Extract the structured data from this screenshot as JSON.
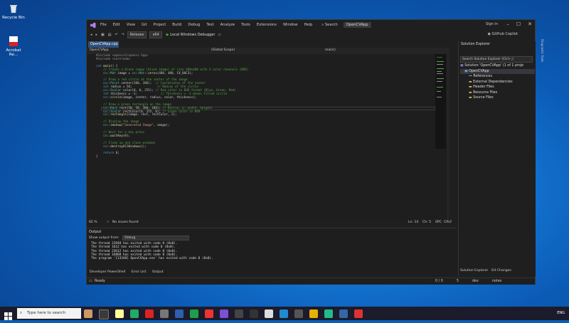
{
  "desktop": {
    "icons": [
      {
        "label": "Recycle Bin"
      },
      {
        "label": "Acrobat Re..."
      }
    ]
  },
  "titlebar": {
    "menu": [
      "File",
      "Edit",
      "View",
      "Git",
      "Project",
      "Build",
      "Debug",
      "Test",
      "Analyze",
      "Tools",
      "Extensions",
      "Window",
      "Help"
    ],
    "search": "Search",
    "app_title": "OpenCVApp",
    "sign_in": "Sign in"
  },
  "toolbar": {
    "config": "Release",
    "platform": "x64",
    "run_label": "Local Windows Debugger",
    "copilot": "GitHub Copilot"
  },
  "editor": {
    "doc_tab": "OpenCVApp.cpp",
    "nav_project": "OpenCVApp",
    "nav_scope": "(Global Scope)",
    "nav_func": "main()",
    "zoom": "82 %",
    "issues": "No issues found",
    "ln": "Ln: 14",
    "ch": "Ch: 5",
    "spc": "SPC",
    "crlf": "CRLF"
  },
  "solution": {
    "title": "Solution Explorer",
    "search_placeholder": "Search Solution Explorer (Ctrl+;)",
    "items": [
      "Solution 'OpenCVApp' (1 of 1 proje",
      "OpenCVApp",
      "References",
      "External Dependencies",
      "Header Files",
      "Resource Files",
      "Source Files"
    ],
    "tab1": "Solution Explorer",
    "tab2": "Git Changes"
  },
  "output": {
    "title": "Output",
    "from_label": "Show output from:",
    "from_value": "Debug",
    "lines": [
      "The thread 23948 has exited with code 0 (0x0).",
      "The thread 1612 has exited with code 0 (0x0).",
      "The thread 23612 has exited with code 0 (0x0).",
      "The thread 16868 has exited with code 0 (0x0).",
      "The program '[13348] OpenCVApp.exe' has exited with code 0 (0x0)."
    ]
  },
  "bottom_tabs": [
    "Developer PowerShell",
    "Error List",
    "Output"
  ],
  "statusbar": {
    "ready": "Ready",
    "errors": "0 / 0",
    "warnings": "5",
    "branch": "dev",
    "notes": "notes"
  },
  "right_strip": "Diagnostic Tools",
  "taskbar": {
    "search": "Type here to search",
    "lang": "ENG"
  }
}
